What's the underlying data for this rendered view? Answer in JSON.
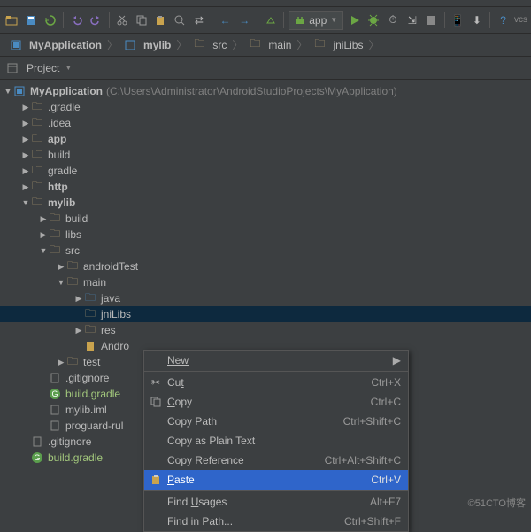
{
  "toolbar": {
    "app_label": "app"
  },
  "breadcrumb": {
    "items": [
      "MyApplication",
      "mylib",
      "src",
      "main",
      "jniLibs"
    ]
  },
  "project_view": {
    "label": "Project"
  },
  "tree": {
    "root": {
      "name": "MyApplication",
      "path": "(C:\\Users\\Administrator\\AndroidStudioProjects\\MyApplication)"
    },
    "n_gradle": ".gradle",
    "n_idea": ".idea",
    "n_app": "app",
    "n_build": "build",
    "n_gradle2": "gradle",
    "n_http": "http",
    "n_mylib": "mylib",
    "n_mylib_build": "build",
    "n_mylib_libs": "libs",
    "n_mylib_src": "src",
    "n_androidTest": "androidTest",
    "n_main": "main",
    "n_java": "java",
    "n_jniLibs": "jniLibs",
    "n_res": "res",
    "n_android": "Andro",
    "n_test": "test",
    "n_gitignore": ".gitignore",
    "n_buildgradle": "build.gradle",
    "n_myliiml": "mylib.iml",
    "n_proguard": "proguard-rul",
    "n_gitignore2": ".gitignore",
    "n_buildgradle2": "build.gradle"
  },
  "context_menu": {
    "new": "New",
    "cut": "Cut",
    "cut_k": "Ctrl+X",
    "cut_u": "t",
    "copy": "Copy",
    "copy_k": "Ctrl+C",
    "copy_u": "C",
    "copy_path": "Copy Path",
    "copy_path_k": "Ctrl+Shift+C",
    "copy_plain": "Copy as Plain Text",
    "copy_ref": "Copy Reference",
    "copy_ref_k": "Ctrl+Alt+Shift+C",
    "paste": "Paste",
    "paste_k": "Ctrl+V",
    "paste_u": "P",
    "find_usages": "Find Usages",
    "find_usages_k": "Alt+F7",
    "find_usages_u": "U",
    "find_in_path": "Find in Path...",
    "find_in_path_k": "Ctrl+Shift+F"
  },
  "watermark": "©51CTO博客"
}
